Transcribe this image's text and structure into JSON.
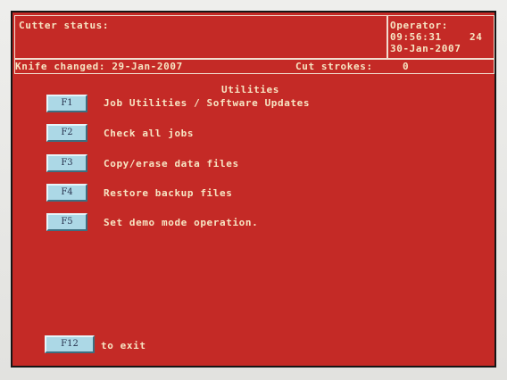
{
  "header": {
    "cutter_status_label": "Cutter status:",
    "operator_label": "Operator:",
    "time": "09:56:31",
    "time_suffix": "24",
    "date": "30-Jan-2007"
  },
  "knife_bar": {
    "knife_changed": "Knife changed: 29-Jan-2007",
    "cut_strokes_label": "Cut strokes:",
    "cut_strokes_value": "0"
  },
  "menu": {
    "title": "Utilities",
    "items": [
      {
        "key": "F1",
        "label": "Job Utilities / Software Updates"
      },
      {
        "key": "F2",
        "label": "Check all jobs"
      },
      {
        "key": "F3",
        "label": "Copy/erase data files"
      },
      {
        "key": "F4",
        "label": "Restore backup files"
      },
      {
        "key": "F5",
        "label": "Set demo mode operation."
      }
    ]
  },
  "exit": {
    "key": "F12",
    "label": "to exit"
  },
  "colors": {
    "screen_background": "#c42a26",
    "text": "#f7e6c4",
    "function_key": "#acd8e6"
  }
}
